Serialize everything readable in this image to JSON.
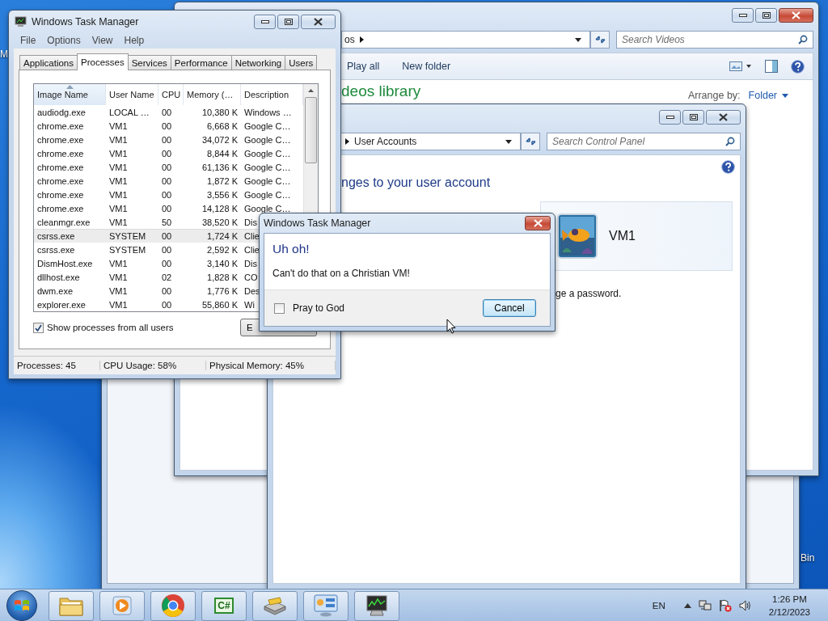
{
  "desktop": {
    "icons": [
      {
        "label": "M"
      },
      {
        "label": "Bin"
      }
    ]
  },
  "explorer": {
    "address": "os",
    "search": {
      "placeholder": "Search Videos"
    },
    "toolbar": [
      "Play all",
      "New folder"
    ],
    "heading": "deos library",
    "arrange_label": "Arrange by:",
    "arrange_value": "Folder"
  },
  "control_panel": {
    "address": "User Accounts",
    "search": {
      "placeholder": "Search Control Panel"
    },
    "heading": "nges to your user account",
    "user": {
      "name": "VM1"
    },
    "link": "ge a password."
  },
  "task_manager": {
    "title": "Windows Task Manager",
    "menu": [
      "File",
      "Options",
      "View",
      "Help"
    ],
    "tabs": [
      {
        "label": "Applications",
        "selected": false
      },
      {
        "label": "Processes",
        "selected": true
      },
      {
        "label": "Services",
        "selected": false
      },
      {
        "label": "Performance",
        "selected": false
      },
      {
        "label": "Networking",
        "selected": false
      },
      {
        "label": "Users",
        "selected": false
      }
    ],
    "columns": [
      "Image Name",
      "User Name",
      "CPU",
      "Memory (…",
      "Description"
    ],
    "rows": [
      {
        "cells": [
          "audiodg.exe",
          "LOCAL …",
          "00",
          "10,380 K",
          "Windows …"
        ],
        "selected": false
      },
      {
        "cells": [
          "chrome.exe",
          "VM1",
          "00",
          "6,668 K",
          "Google C…"
        ],
        "selected": false
      },
      {
        "cells": [
          "chrome.exe",
          "VM1",
          "00",
          "34,072 K",
          "Google C…"
        ],
        "selected": false
      },
      {
        "cells": [
          "chrome.exe",
          "VM1",
          "00",
          "8,844 K",
          "Google C…"
        ],
        "selected": false
      },
      {
        "cells": [
          "chrome.exe",
          "VM1",
          "00",
          "61,136 K",
          "Google C…"
        ],
        "selected": false
      },
      {
        "cells": [
          "chrome.exe",
          "VM1",
          "00",
          "1,872 K",
          "Google C…"
        ],
        "selected": false
      },
      {
        "cells": [
          "chrome.exe",
          "VM1",
          "00",
          "3,556 K",
          "Google C…"
        ],
        "selected": false
      },
      {
        "cells": [
          "chrome.exe",
          "VM1",
          "00",
          "14,128 K",
          "Google C…"
        ],
        "selected": false
      },
      {
        "cells": [
          "cleanmgr.exe",
          "VM1",
          "50",
          "38,520 K",
          "Dis"
        ],
        "selected": false
      },
      {
        "cells": [
          "csrss.exe",
          "SYSTEM",
          "00",
          "1,724 K",
          "Clie"
        ],
        "selected": true
      },
      {
        "cells": [
          "csrss.exe",
          "SYSTEM",
          "00",
          "2,592 K",
          "Clie"
        ],
        "selected": false
      },
      {
        "cells": [
          "DismHost.exe",
          "VM1",
          "00",
          "3,140 K",
          "Dis"
        ],
        "selected": false
      },
      {
        "cells": [
          "dllhost.exe",
          "VM1",
          "02",
          "1,828 K",
          "CO"
        ],
        "selected": false
      },
      {
        "cells": [
          "dwm.exe",
          "VM1",
          "00",
          "1,776 K",
          "Des"
        ],
        "selected": false
      },
      {
        "cells": [
          "explorer.exe",
          "VM1",
          "00",
          "55,860 K",
          "Wi"
        ],
        "selected": false
      }
    ],
    "show_all": {
      "label": "Show processes from all users",
      "checked": true
    },
    "end_button": "E",
    "status": [
      "Processes: 45",
      "CPU Usage: 58%",
      "Physical Memory: 45%"
    ]
  },
  "dialog": {
    "title": "Windows Task Manager",
    "heading": "Uh oh!",
    "message": "Can't do that on a Christian VM!",
    "checkbox": {
      "label": "Pray to God",
      "checked": false
    },
    "button": "Cancel"
  },
  "taskbar": {
    "apps": [
      {
        "kind": "folder"
      },
      {
        "kind": "media"
      },
      {
        "kind": "browser"
      },
      {
        "kind": "code",
        "label": "C#"
      },
      {
        "kind": "drive"
      },
      {
        "kind": "panel"
      },
      {
        "kind": "monitor"
      }
    ],
    "language": "EN",
    "time": "1:26 PM",
    "date": "2/12/2023"
  }
}
